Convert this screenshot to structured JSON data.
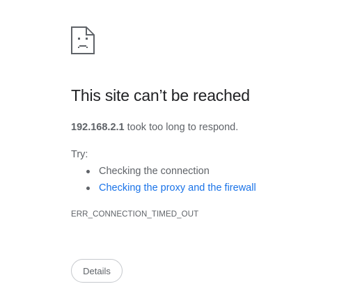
{
  "error": {
    "icon": "sad-page-icon",
    "title": "This site can’t be reached",
    "summary": {
      "host": "192.168.2.1",
      "message": " took too long to respond."
    },
    "try_label": "Try:",
    "suggestions": [
      {
        "label": "Checking the connection",
        "link": false
      },
      {
        "label": "Checking the proxy and the firewall",
        "link": true
      }
    ],
    "code": "ERR_CONNECTION_TIMED_OUT",
    "details_label": "Details"
  },
  "colors": {
    "text": "#5f6368",
    "title": "#202124",
    "link": "#1a73e8",
    "button_border": "#c6c9cd"
  }
}
